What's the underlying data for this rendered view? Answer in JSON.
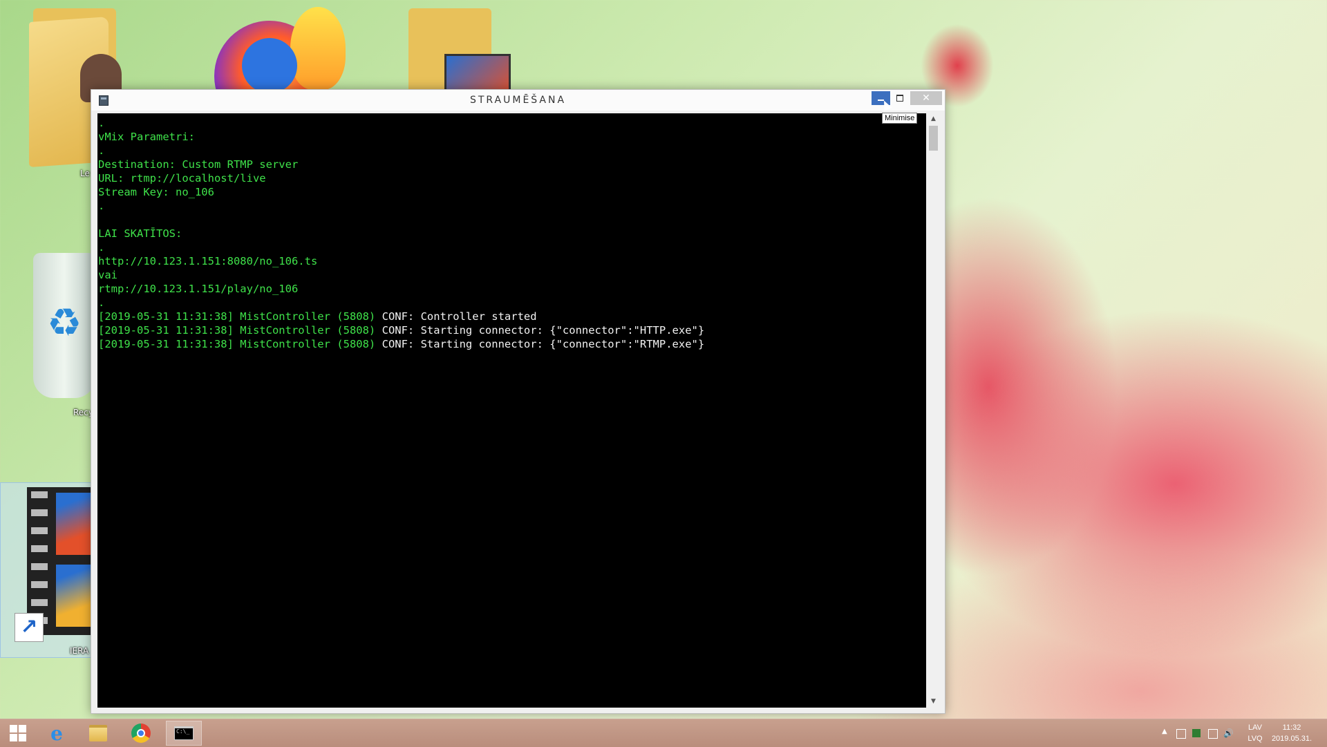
{
  "desktop": {
    "icons": [
      {
        "label": "Le"
      },
      {
        "label": "Recy"
      },
      {
        "label": "IERA"
      }
    ]
  },
  "window": {
    "title": "STRAUMĒŠANA",
    "tooltip": "Minimise",
    "console_lines": [
      [
        {
          "t": ".",
          "c": "g"
        }
      ],
      [
        {
          "t": "vMix Parametri:",
          "c": "g"
        }
      ],
      [
        {
          "t": ".",
          "c": "g"
        }
      ],
      [
        {
          "t": "Destination: Custom RTMP server",
          "c": "g"
        }
      ],
      [
        {
          "t": "URL: rtmp://localhost/live",
          "c": "g"
        }
      ],
      [
        {
          "t": "Stream Key: no_106",
          "c": "g"
        }
      ],
      [
        {
          "t": ".",
          "c": "g"
        }
      ],
      [
        {
          "t": "",
          "c": "g"
        }
      ],
      [
        {
          "t": "LAI SKATĪTOS:",
          "c": "g"
        }
      ],
      [
        {
          "t": ".",
          "c": "g"
        }
      ],
      [
        {
          "t": "http://10.123.1.151:8080/no_106.ts",
          "c": "g"
        }
      ],
      [
        {
          "t": "vai",
          "c": "g"
        }
      ],
      [
        {
          "t": "rtmp://10.123.1.151/play/no_106",
          "c": "g"
        }
      ],
      [
        {
          "t": ".",
          "c": "g"
        }
      ],
      [
        {
          "t": "[2019-05-31 11:31:38] MistController (5808) ",
          "c": "g"
        },
        {
          "t": "CONF: Controller started",
          "c": "w"
        }
      ],
      [
        {
          "t": "[2019-05-31 11:31:38] MistController (5808) ",
          "c": "g"
        },
        {
          "t": "CONF: Starting connector: {\"connector\":\"HTTP.exe\"}",
          "c": "w"
        }
      ],
      [
        {
          "t": "[2019-05-31 11:31:38] MistController (5808) ",
          "c": "g"
        },
        {
          "t": "CONF: Starting connector: {\"connector\":\"RTMP.exe\"}",
          "c": "w"
        }
      ]
    ]
  },
  "taskbar": {
    "items": [
      {
        "icon": "windows-start-icon"
      },
      {
        "icon": "internet-explorer-icon"
      },
      {
        "icon": "file-explorer-icon"
      },
      {
        "icon": "chrome-icon"
      },
      {
        "icon": "command-prompt-icon",
        "active": true
      }
    ],
    "tray": {
      "lang_top": "LAV",
      "lang_bottom": "LVQ",
      "time": "11:32",
      "date": "2019.05.31."
    }
  },
  "colors": {
    "console_green": "#3fe24a",
    "console_white": "#f2f2f2",
    "minimize_active": "#3c6fbf"
  }
}
